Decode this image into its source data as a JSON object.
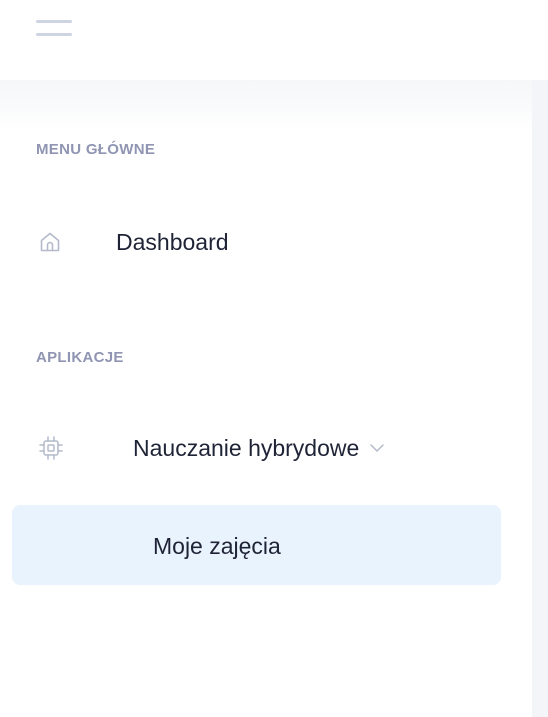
{
  "topbar": {
    "menu_icon": "hamburger-menu-icon"
  },
  "sidebar": {
    "sections": [
      {
        "title": "MENU GŁÓWNE",
        "items": [
          {
            "label": "Dashboard",
            "icon": "home-icon"
          }
        ]
      },
      {
        "title": "APLIKACJE",
        "items": [
          {
            "label": "Nauczanie hybrydowe",
            "icon": "chip-icon",
            "expanded": true,
            "chevron_icon": "chevron-down-icon",
            "children": [
              {
                "label": "Moje zajęcia",
                "active": true
              }
            ]
          }
        ]
      }
    ]
  },
  "colors": {
    "section_title": "#8f95b2",
    "item_text": "#1f2336",
    "icon": "#b4bacb",
    "active_bg": "#e9f3fd",
    "hamburger": "#cfd4e2"
  }
}
